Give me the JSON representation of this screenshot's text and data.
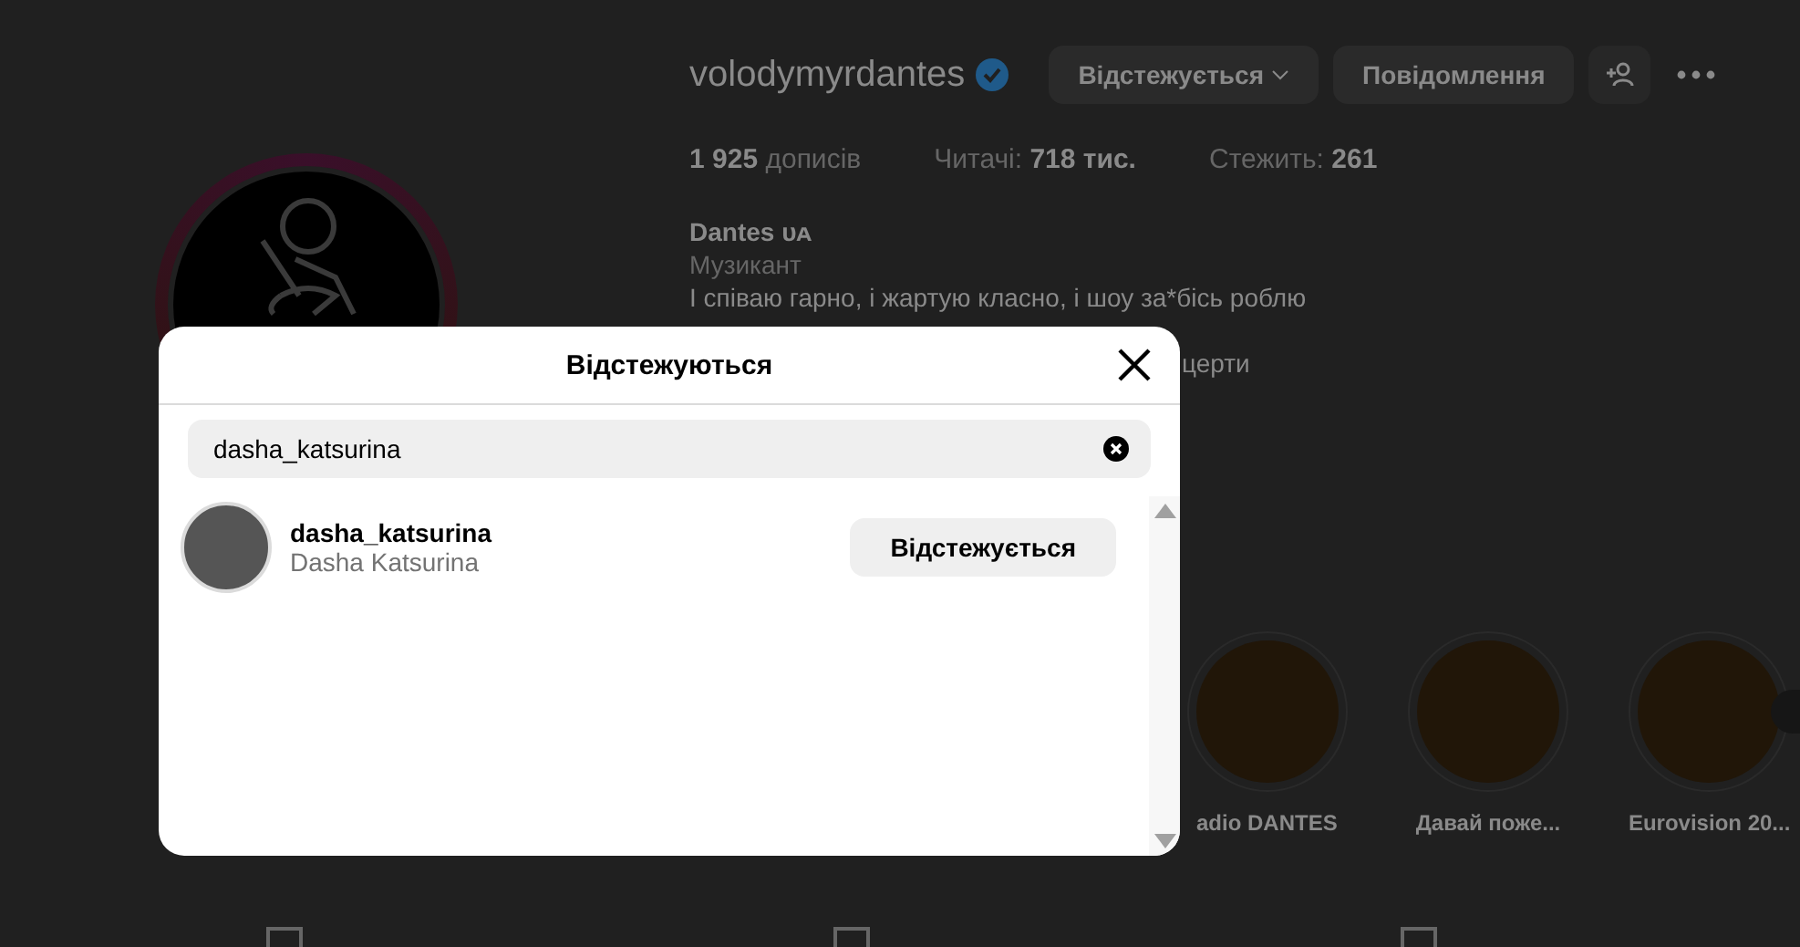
{
  "profile": {
    "username": "volodymyrdantes",
    "follow_button": "Відстежується",
    "message_button": "Повідомлення",
    "stats": [
      {
        "kind": "value_first",
        "value": "1 925",
        "label": "дописів"
      },
      {
        "kind": "label_first",
        "label": "Читачі:",
        "value": "718 тис."
      },
      {
        "kind": "label_first",
        "label": "Стежить:",
        "value": "261"
      }
    ],
    "name": "Dantes",
    "name_tag": "ᴜᴀ",
    "category": "Музикант",
    "bio_lines": [
      "І співаю гарно, і жартую класно, і шоу за*бісь роблю",
      "церти"
    ],
    "highlights": [
      {
        "label": "adio DANTES"
      },
      {
        "label": "Давай поже..."
      },
      {
        "label": "Eurovision 20..."
      }
    ]
  },
  "modal": {
    "title": "Відстежуються",
    "search": {
      "value": "dasha_katsurina"
    },
    "results": [
      {
        "username": "dasha_katsurina",
        "full_name": "Dasha Katsurina",
        "button": "Відстежується"
      }
    ]
  }
}
